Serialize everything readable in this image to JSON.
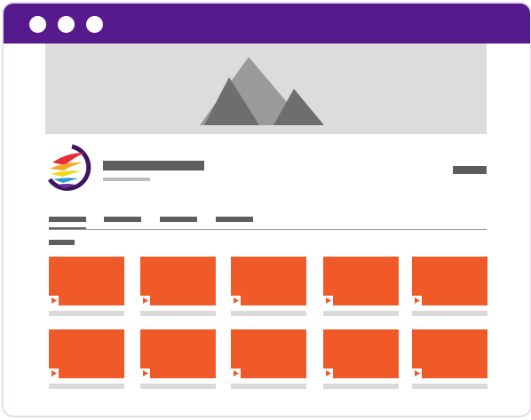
{
  "window": {
    "titlebar_color": "#561a8c",
    "controls": [
      "window-dot-1",
      "window-dot-2",
      "window-dot-3"
    ]
  },
  "colors": {
    "banner_bg": "#dcdcdc",
    "placeholder_dark": "#5e5e5e",
    "placeholder_light": "#dadada",
    "thumbnail": "#f05a29",
    "logo_ring": "#3d1460",
    "logo_stripes": [
      "#e62e3b",
      "#f5a623",
      "#f0d81f",
      "#2a9bd6",
      "#6a2fa0"
    ]
  },
  "icons": {
    "banner": "mountain-landscape-icon",
    "channel": "channel-logo-icon",
    "play": "play-icon"
  },
  "channel": {
    "name": "",
    "subtitle": "",
    "subscribe_label": ""
  },
  "tabs": [
    {
      "label": "",
      "active": true
    },
    {
      "label": "",
      "active": false
    },
    {
      "label": "",
      "active": false
    },
    {
      "label": "",
      "active": false
    }
  ],
  "section": {
    "title": ""
  },
  "videos": [
    {
      "title": ""
    },
    {
      "title": ""
    },
    {
      "title": ""
    },
    {
      "title": ""
    },
    {
      "title": ""
    },
    {
      "title": ""
    },
    {
      "title": ""
    },
    {
      "title": ""
    },
    {
      "title": ""
    },
    {
      "title": ""
    }
  ]
}
